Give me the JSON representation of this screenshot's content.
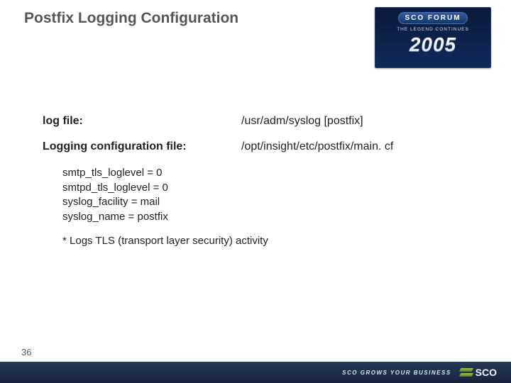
{
  "header": {
    "title": "Postfix Logging Configuration",
    "logo": {
      "forum": "SCO FORUM",
      "tagline": "THE LEGEND CONTINUES",
      "year": "2005"
    }
  },
  "content": {
    "rows": [
      {
        "label": "log file:",
        "value": "/usr/adm/syslog [postfix]"
      },
      {
        "label": "Logging configuration file:",
        "value": "/opt/insight/etc/postfix/main. cf"
      }
    ],
    "settings": [
      "smtp_tls_loglevel = 0",
      "smtpd_tls_loglevel = 0",
      "syslog_facility = mail",
      "syslog_name = postfix"
    ],
    "footnote": "* Logs TLS (transport layer security) activity"
  },
  "footer": {
    "page": "36",
    "tagline": "SCO GROWS YOUR BUSINESS",
    "brand": "SCO"
  }
}
